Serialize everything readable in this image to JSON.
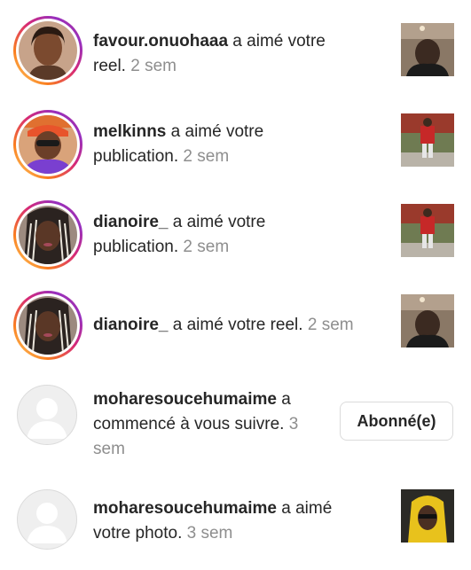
{
  "notifications": [
    {
      "username": "favour.onuohaaa",
      "action": " a aimé votre reel.",
      "time": "2 sem"
    },
    {
      "username": "melkinns",
      "action": " a aimé votre publication.",
      "time": "2 sem"
    },
    {
      "username": "dianoire_",
      "action": " a aimé votre publication.",
      "time": "2 sem"
    },
    {
      "username": "dianoire_",
      "action": " a aimé votre reel.",
      "time": "2 sem"
    },
    {
      "username": "moharesoucehumaime",
      "action": " a commencé à vous suivre.",
      "time": "3 sem",
      "button": "Abonné(e)"
    },
    {
      "username": "moharesoucehumaime",
      "action": " a aimé votre photo.",
      "time": "3 sem"
    }
  ]
}
